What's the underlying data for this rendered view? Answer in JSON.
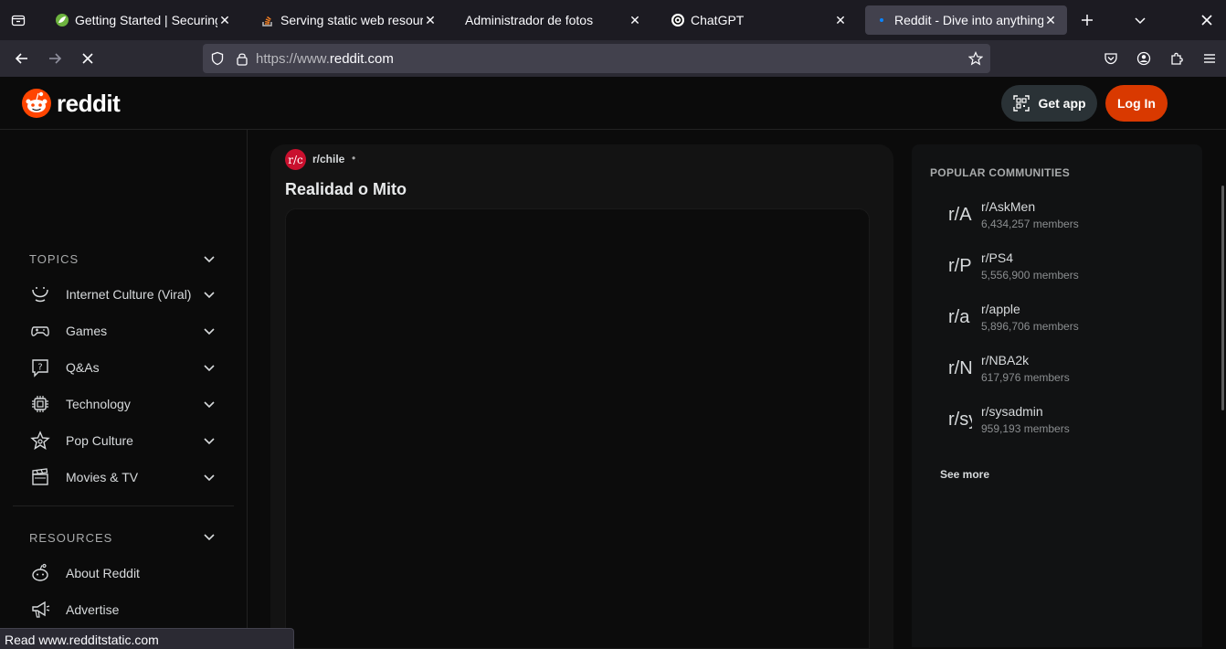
{
  "browser": {
    "tabs": [
      {
        "title": "Getting Started | Securing a Web Application",
        "favicon": "spring-leaf-icon",
        "active": false
      },
      {
        "title": "Serving static web resources",
        "favicon": "stackoverflow-icon",
        "active": false
      },
      {
        "title": "Administrador de fotos",
        "favicon": "",
        "active": false
      },
      {
        "title": "ChatGPT",
        "favicon": "openai-icon",
        "active": false
      },
      {
        "title": "Reddit - Dive into anything",
        "favicon": "loading-dot-icon",
        "active": true
      }
    ],
    "url_scheme": "https://www.",
    "url_host": "reddit.com",
    "status_text": "Read www.redditstatic.com"
  },
  "header": {
    "logo_text": "reddit",
    "get_app_label": "Get app",
    "login_label": "Log In"
  },
  "sidebar": {
    "topics_heading": "TOPICS",
    "topics": [
      {
        "label": "Internet Culture (Viral)",
        "icon": "smile-face-icon"
      },
      {
        "label": "Games",
        "icon": "gamepad-icon"
      },
      {
        "label": "Q&As",
        "icon": "question-bubble-icon"
      },
      {
        "label": "Technology",
        "icon": "chip-icon"
      },
      {
        "label": "Pop Culture",
        "icon": "star-icon"
      },
      {
        "label": "Movies & TV",
        "icon": "clapperboard-icon"
      }
    ],
    "resources_heading": "RESOURCES",
    "resources": [
      {
        "label": "About Reddit",
        "icon": "reddit-alien-icon"
      },
      {
        "label": "Advertise",
        "icon": "megaphone-icon"
      }
    ]
  },
  "post": {
    "subreddit_avatar": "r/c",
    "subreddit": "r/chile",
    "separator": "•",
    "title": "Realidad o Mito"
  },
  "popular": {
    "heading": "POPULAR COMMUNITIES",
    "communities": [
      {
        "avatar": "r/A",
        "name": "r/AskMen",
        "members": "6,434,257 members"
      },
      {
        "avatar": "r/P",
        "name": "r/PS4",
        "members": "5,556,900 members"
      },
      {
        "avatar": "r/a",
        "name": "r/apple",
        "members": "5,896,706 members"
      },
      {
        "avatar": "r/N",
        "name": "r/NBA2k",
        "members": "617,976 members"
      },
      {
        "avatar": "r/sy",
        "name": "r/sysadmin",
        "members": "959,193 members"
      }
    ],
    "see_more": "See more"
  },
  "colors": {
    "accent_login": "#d93900",
    "page_bg": "#0b0b0b",
    "subreddit_avatar_bg": "#c9102e"
  }
}
